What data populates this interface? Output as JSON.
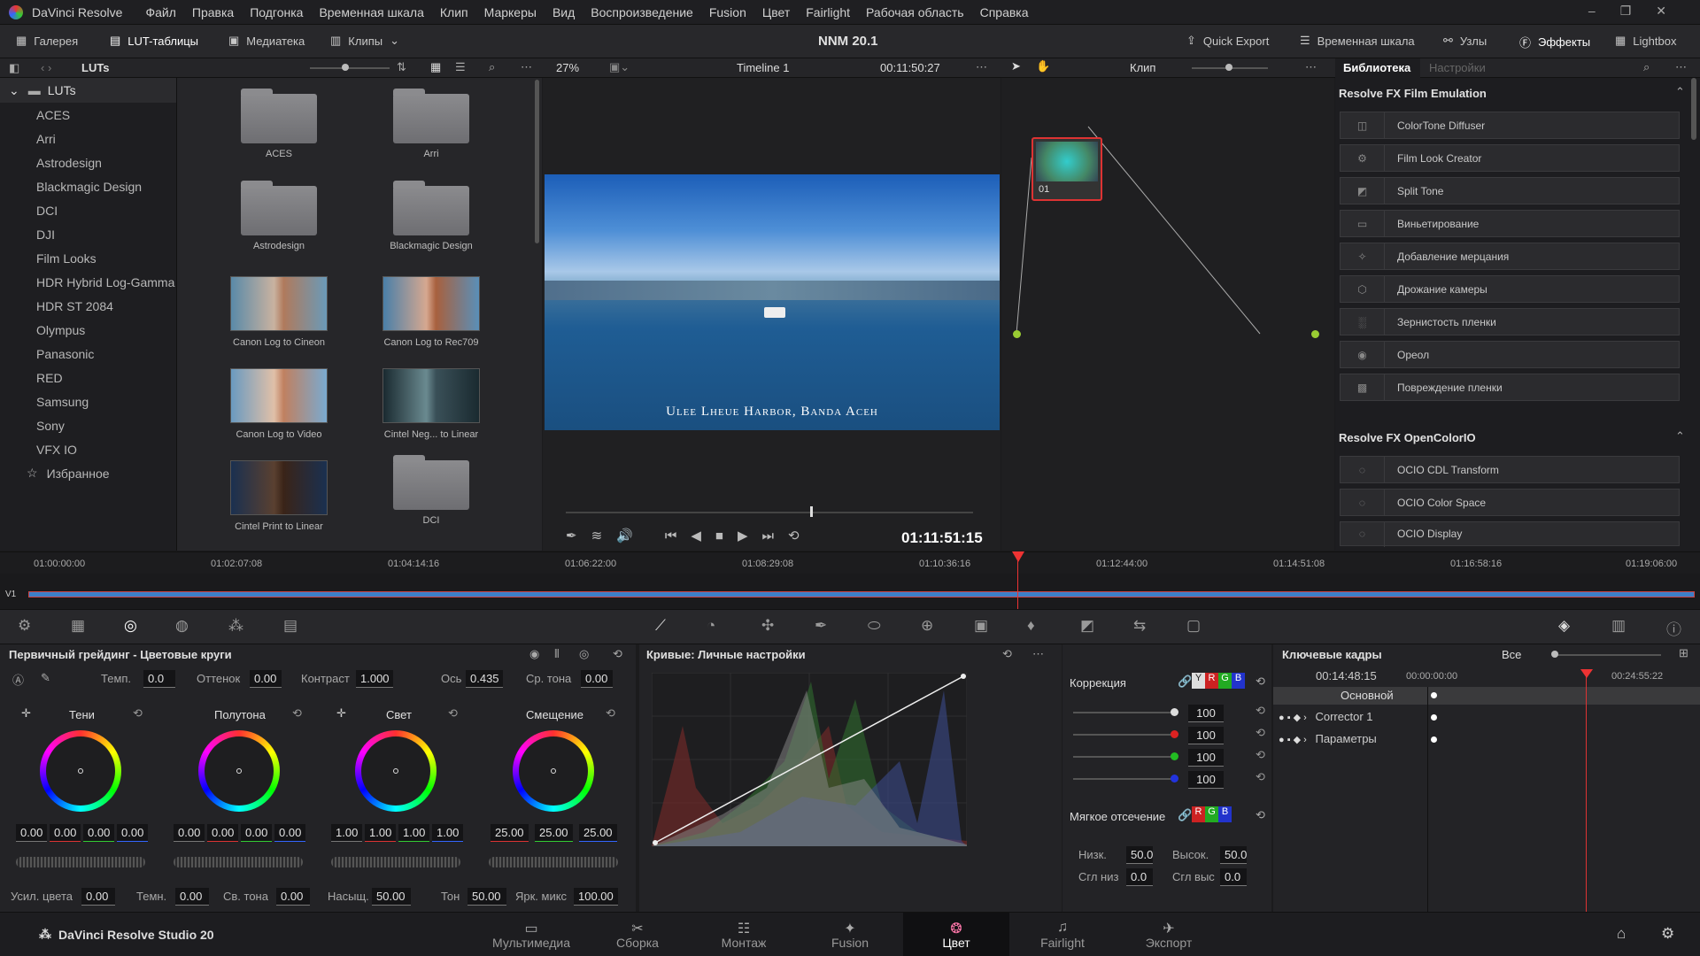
{
  "menu": {
    "app": "DaVinci Resolve",
    "items": [
      "Файл",
      "Правка",
      "Подгонка",
      "Временная шкала",
      "Клип",
      "Маркеры",
      "Вид",
      "Воспроизведение",
      "Fusion",
      "Цвет",
      "Fairlight",
      "Рабочая область",
      "Справка"
    ]
  },
  "toolbar": {
    "gallery": "Галерея",
    "luts": "LUT-таблицы",
    "media": "Медиатека",
    "clips": "Клипы",
    "project": "NNM 20.1",
    "quick_export": "Quick Export",
    "timeline": "Временная шкала",
    "nodes": "Узлы",
    "effects": "Эффекты",
    "lightbox": "Lightbox"
  },
  "strip": {
    "luts_title": "LUTs",
    "zoom": "27%",
    "timeline_name": "Timeline 1",
    "timecode": "00:11:50:27",
    "clip_mode": "Клип",
    "tab_library": "Библиотека",
    "tab_settings": "Настройки"
  },
  "tree": {
    "root": "LUTs",
    "items": [
      "ACES",
      "Arri",
      "Astrodesign",
      "Blackmagic Design",
      "DCI",
      "DJI",
      "Film Looks",
      "HDR Hybrid Log-Gamma",
      "HDR ST 2084",
      "Olympus",
      "Panasonic",
      "RED",
      "Samsung",
      "Sony",
      "VFX IO"
    ],
    "favorites": "Избранное"
  },
  "grid": {
    "items": [
      "ACES",
      "Arri",
      "Astrodesign",
      "Blackmagic Design",
      "Canon Log to Cineon",
      "Canon Log to Rec709",
      "Canon Log to Video",
      "Cintel Neg... to Linear",
      "Cintel Print to Linear",
      "DCI"
    ]
  },
  "viewer": {
    "caption": "Ulee Lheue Harbor, Banda Aceh",
    "timecode": "01:11:51:15"
  },
  "node": {
    "label": "01"
  },
  "library": {
    "section1": "Resolve FX Film Emulation",
    "fx1": [
      "ColorTone Diffuser",
      "Film Look Creator",
      "Split Tone",
      "Виньетирование",
      "Добавление мерцания",
      "Дрожание камеры",
      "Зернистость пленки",
      "Ореол",
      "Повреждение пленки"
    ],
    "section2": "Resolve FX OpenColorIO",
    "fx2": [
      "OCIO CDL Transform",
      "OCIO Color Space",
      "OCIO Display"
    ]
  },
  "ruler": {
    "ticks": [
      "01:00:00:00",
      "01:02:07:08",
      "01:04:14:16",
      "01:06:22:00",
      "01:08:29:08",
      "01:10:36:16",
      "01:12:44:00",
      "01:14:51:08",
      "01:16:58:16",
      "01:19:06:00"
    ],
    "track": "V1"
  },
  "wheels": {
    "title": "Первичный грейдинг - Цветовые круги",
    "temp_l": "Темп.",
    "temp": "0.0",
    "tint_l": "Оттенок",
    "tint": "0.00",
    "contrast_l": "Контраст",
    "contrast": "1.000",
    "pivot_l": "Ось",
    "pivot": "0.435",
    "mid_l": "Ср. тона",
    "mid": "0.00",
    "names": [
      "Тени",
      "Полутона",
      "Свет",
      "Смещение"
    ],
    "vals": [
      [
        "0.00",
        "0.00",
        "0.00",
        "0.00"
      ],
      [
        "0.00",
        "0.00",
        "0.00",
        "0.00"
      ],
      [
        "1.00",
        "1.00",
        "1.00",
        "1.00"
      ],
      [
        "25.00",
        "25.00",
        "25.00"
      ]
    ],
    "boost_l": "Усил. цвета",
    "boost": "0.00",
    "shad_l": "Темн.",
    "shad": "0.00",
    "hl_l": "Св. тона",
    "hl": "0.00",
    "sat_l": "Насыщ.",
    "sat": "50.00",
    "hue_l": "Тон",
    "hue": "50.00",
    "lmix_l": "Ярк. микс",
    "lmix": "100.00"
  },
  "curves": {
    "title": "Кривые: Личные настройки"
  },
  "corr": {
    "title": "Коррекция",
    "vals": [
      "100",
      "100",
      "100",
      "100"
    ],
    "soft": "Мягкое отсечение",
    "low_l": "Низк.",
    "low": "50.0",
    "high_l": "Высок.",
    "high": "50.0",
    "ls_l": "Сгл низ",
    "ls": "0.0",
    "hs_l": "Сгл выс",
    "hs": "0.0"
  },
  "keys": {
    "title": "Ключевые кадры",
    "filter": "Все",
    "tc": "00:14:48:15",
    "t0": "00:00:00:00",
    "t1": "00:24:55:22",
    "rows": [
      "Основной",
      "Corrector 1",
      "Параметры"
    ]
  },
  "pages": {
    "brand": "DaVinci Resolve Studio 20",
    "items": [
      "Мультимедиа",
      "Сборка",
      "Монтаж",
      "Fusion",
      "Цвет",
      "Fairlight",
      "Экспорт"
    ]
  }
}
